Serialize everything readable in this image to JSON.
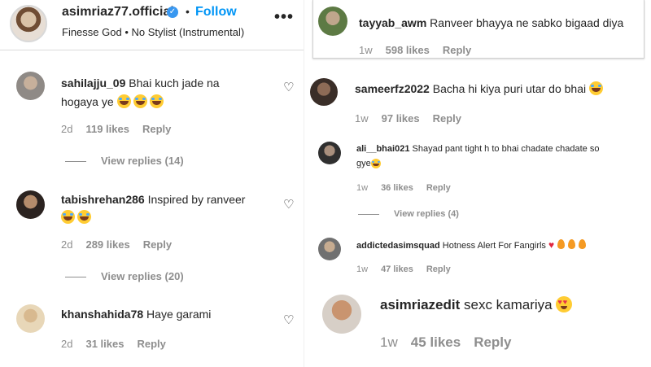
{
  "header": {
    "username": "asimriaz77.official",
    "verified_symbol": "✓",
    "separator": "•",
    "follow_label": "Follow",
    "subtitle": "Finesse God • No Stylist (Instrumental)",
    "more_label": "•••"
  },
  "left_comments": [
    {
      "user": "sahilajju_09",
      "text_line1": "Bhai kuch jade na",
      "text_line2": "hogaya ye",
      "time": "2d",
      "likes": "119 likes",
      "reply": "Reply",
      "view_replies": "View replies (14)"
    },
    {
      "user": "tabishrehan286",
      "text_line1": "Inspired by ranveer",
      "time": "2d",
      "likes": "289 likes",
      "reply": "Reply",
      "view_replies": "View replies (20)"
    },
    {
      "user": "khanshahida78",
      "text_line1": "Haye garami",
      "time": "2d",
      "likes": "31 likes",
      "reply": "Reply"
    }
  ],
  "right_comments": [
    {
      "user": "tayyab_awm",
      "text": "Ranveer bhayya ne sabko bigaad diya",
      "time": "1w",
      "likes": "598 likes",
      "reply": "Reply"
    },
    {
      "user": "sameerfz2022",
      "text": "Bacha hi kiya puri utar do bhai",
      "time": "1w",
      "likes": "97 likes",
      "reply": "Reply"
    },
    {
      "user": "ali__bhai021",
      "text_line1": "Shayad pant tight h to bhai chadate chadate so",
      "text_line2": "gye",
      "time": "1w",
      "likes": "36 likes",
      "reply": "Reply",
      "view_replies": "View replies (4)"
    },
    {
      "user": "addictedasimsquad",
      "text": "Hotness Alert For Fangirls",
      "time": "1w",
      "likes": "47 likes",
      "reply": "Reply"
    },
    {
      "user": "asimriazedit",
      "text": "sexc kamariya",
      "time": "1w",
      "likes": "45 likes",
      "reply": "Reply"
    }
  ],
  "icons": {
    "heart": "♡"
  },
  "colors": {
    "link_blue": "#0095f6",
    "verified_blue": "#3897f0",
    "meta_gray": "#8e8e8e"
  }
}
